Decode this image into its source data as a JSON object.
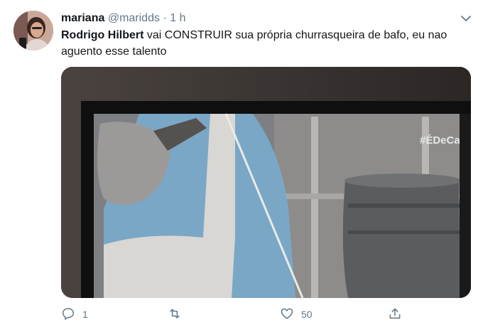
{
  "tweet": {
    "author_name": "mariana",
    "handle": "@maridds",
    "separator": "·",
    "time": "1 h",
    "text_bold": "Rodrigo Hilbert",
    "text_rest": " vai CONSTRUIR sua própria churrasqueira de bafo, eu nao aguento esse talento",
    "tv_hashtag": "#ÉDeCasa"
  },
  "actions": {
    "reply_count": "1",
    "retweet_count": "",
    "like_count": "50"
  },
  "icons": [
    "chevron-down-icon",
    "reply-icon",
    "retweet-icon",
    "like-icon",
    "share-icon"
  ],
  "colors": {
    "text": "#14171a",
    "secondary": "#657786"
  }
}
